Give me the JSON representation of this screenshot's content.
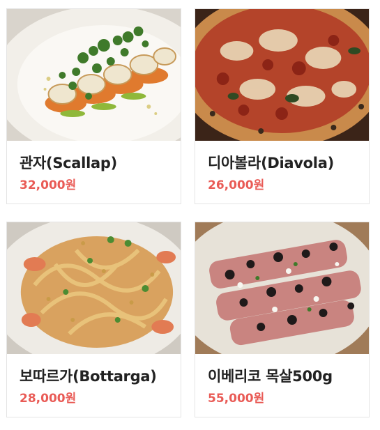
{
  "menu": {
    "items": [
      {
        "name": "관자(Scallap)",
        "price": "32,000원",
        "image": "scallop-dish"
      },
      {
        "name": "디아볼라(Diavola)",
        "price": "26,000원",
        "image": "diavola-pizza"
      },
      {
        "name": "보따르가(Bottarga)",
        "price": "28,000원",
        "image": "bottarga-pasta"
      },
      {
        "name": "이베리코 목살500g",
        "price": "55,000원",
        "image": "iberico-pork"
      }
    ]
  }
}
